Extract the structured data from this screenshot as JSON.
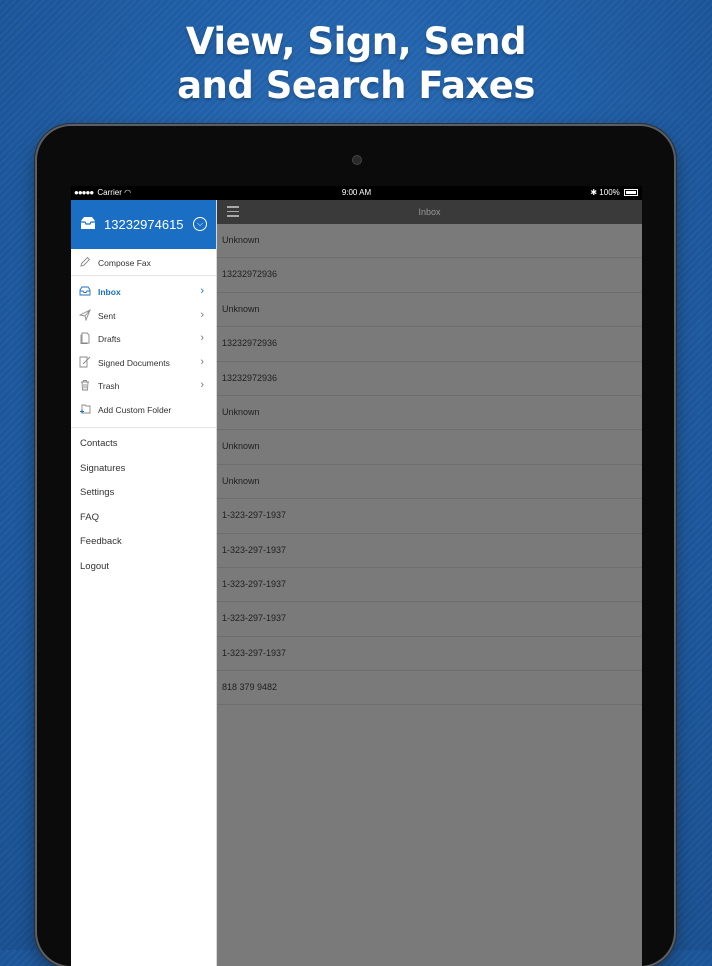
{
  "headline": {
    "line1": "View, Sign, Send",
    "line2": "and Search Faxes"
  },
  "status_bar": {
    "carrier": "Carrier",
    "time": "9:00 AM",
    "battery": "100%"
  },
  "account": {
    "number": "13232974615"
  },
  "sidebar": {
    "compose": "Compose Fax",
    "folders": [
      {
        "label": "Inbox",
        "icon": "inbox-icon",
        "active": true
      },
      {
        "label": "Sent",
        "icon": "send-icon"
      },
      {
        "label": "Drafts",
        "icon": "drafts-icon"
      },
      {
        "label": "Signed Documents",
        "icon": "signed-documents-icon"
      },
      {
        "label": "Trash",
        "icon": "trash-icon"
      }
    ],
    "add_folder": "Add Custom Folder",
    "links": [
      "Contacts",
      "Signatures",
      "Settings",
      "FAQ",
      "Feedback",
      "Logout"
    ]
  },
  "navbar": {
    "title": "Inbox"
  },
  "inbox": {
    "rows": [
      "Unknown",
      "13232972936",
      "Unknown",
      "13232972936",
      "13232972936",
      "Unknown",
      "Unknown",
      "Unknown",
      "1-323-297-1937",
      "1-323-297-1937",
      "1-323-297-1937",
      "1-323-297-1937",
      "1-323-297-1937",
      "818 379 9482"
    ]
  },
  "colors": {
    "accent": "#1a6fc4",
    "background": "#1f5ea6",
    "list_bg": "#7a7a7a",
    "navbar": "#3a3a3a"
  }
}
